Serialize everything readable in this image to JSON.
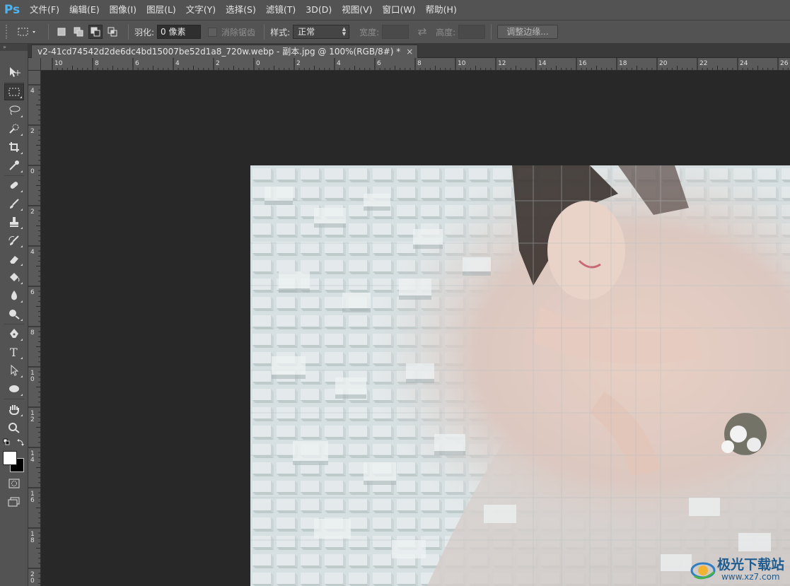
{
  "app": {
    "logo": "Ps"
  },
  "menu": [
    "文件(F)",
    "编辑(E)",
    "图像(I)",
    "图层(L)",
    "文字(Y)",
    "选择(S)",
    "滤镜(T)",
    "3D(D)",
    "视图(V)",
    "窗口(W)",
    "帮助(H)"
  ],
  "options": {
    "feather_label": "羽化:",
    "feather_value": "0 像素",
    "antialias_label": "消除锯齿",
    "style_label": "样式:",
    "style_value": "正常",
    "width_label": "宽度:",
    "height_label": "高度:",
    "refine_edge_label": "调整边缘..."
  },
  "toolspanel": {
    "header": "»"
  },
  "document": {
    "tab_title": "v2-41cd74542d2de6dc4bd15007be52d1a8_720w.webp - 副本.jpg @ 100%(RGB/8#) *",
    "close_label": "×"
  },
  "rulers": {
    "horizontal": [
      "10",
      "8",
      "6",
      "4",
      "2",
      "0",
      "2",
      "4",
      "6",
      "8",
      "10",
      "12",
      "14",
      "16",
      "18",
      "20",
      "22",
      "24",
      "26"
    ],
    "vertical": [
      "4",
      "2",
      "0",
      "2",
      "4",
      "6",
      "8",
      "1 0",
      "1 2",
      "1 4",
      "1 6",
      "1 8",
      "2 0"
    ]
  },
  "watermark": {
    "title": "极光下载站",
    "url": "www.xz7.com"
  },
  "colors": {
    "accent": "#4fb3f0",
    "ui_bg": "#535353",
    "canvas_bg": "#282828",
    "brand_watermark": "#1f5c8f"
  }
}
